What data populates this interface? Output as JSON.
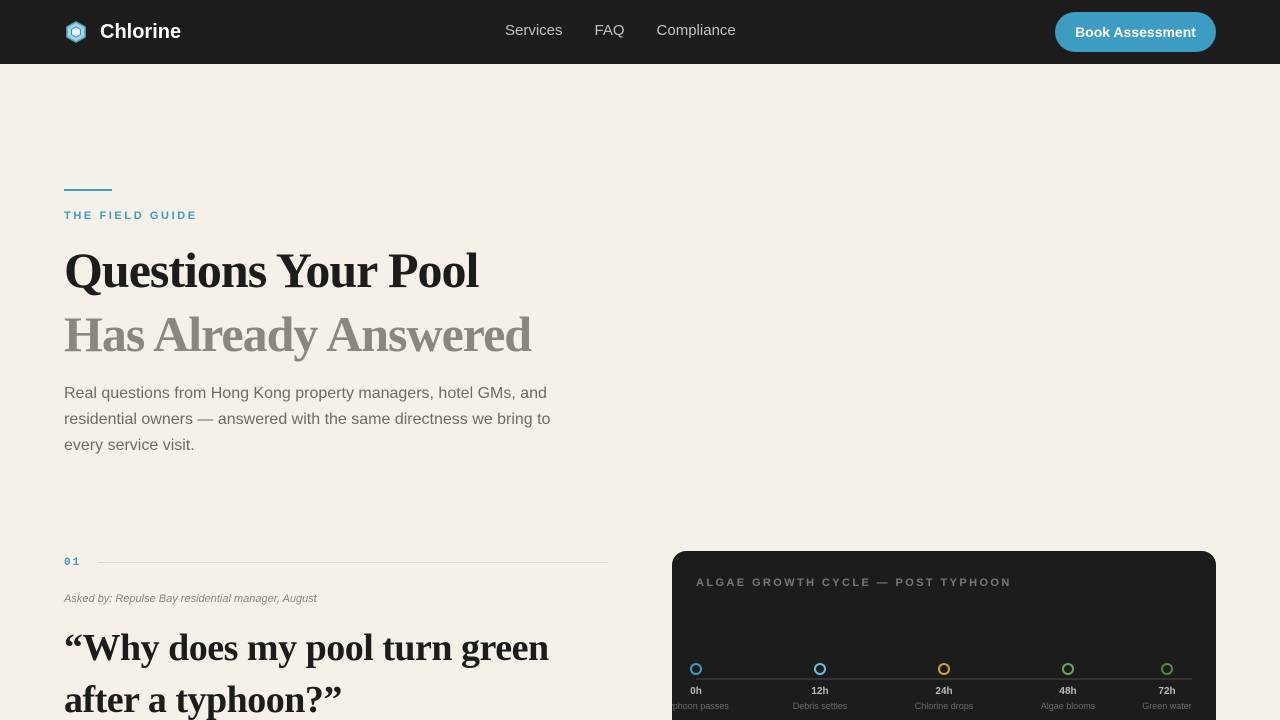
{
  "nav": {
    "brand": "Chlorine",
    "links": [
      "Services",
      "FAQ",
      "Compliance"
    ],
    "cta": "Book Assessment"
  },
  "hero": {
    "eyebrow": "THE FIELD GUIDE",
    "title_line1": "Questions Your Pool",
    "title_line2": "Has Already Answered",
    "lede": "Real questions from Hong Kong property managers, hotel GMs, and residential owners — answered with the same directness we bring to every service visit."
  },
  "question": {
    "number": "01",
    "asked": "Asked by: Repulse Bay residential manager, August",
    "title": "“Why does my pool turn green after a typhoon?”"
  },
  "timeline_card": {
    "title": "ALGAE GROWTH CYCLE — POST TYPHOON",
    "stages": [
      {
        "hour": "0h",
        "label": "Typhoon passes",
        "color": "#3d9cc2"
      },
      {
        "hour": "12h",
        "label": "Debris settles",
        "color": "#6cc0e0"
      },
      {
        "hour": "24h",
        "label": "Chlorine drops",
        "color": "#d4a047"
      },
      {
        "hour": "48h",
        "label": "Algae blooms",
        "color": "#6aa858"
      },
      {
        "hour": "72h",
        "label": "Green water",
        "color": "#4f8a3e"
      }
    ]
  }
}
